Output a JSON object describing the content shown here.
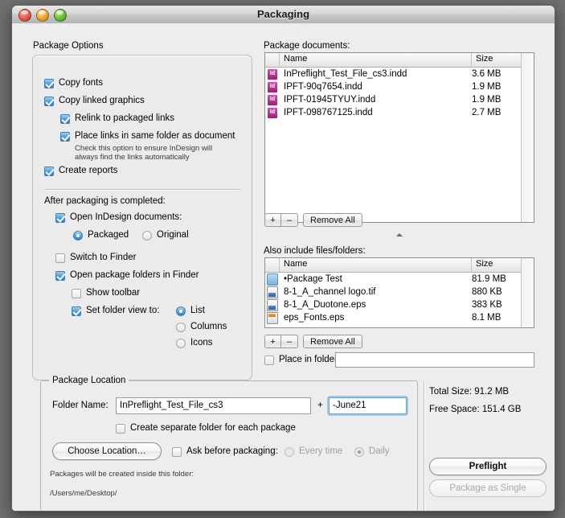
{
  "window": {
    "title": "Packaging"
  },
  "options_panel": {
    "title": "Package Options",
    "copy_fonts": "Copy fonts",
    "copy_linked_graphics": "Copy linked graphics",
    "relink": "Relink to packaged links",
    "place_links": "Place links in same folder as document",
    "hint_line1": "Check this option to ensure InDesign will",
    "hint_line2": "always find the links automatically",
    "create_reports": "Create reports",
    "after_packaging": "After packaging is completed:",
    "open_indesign_docs": "Open InDesign documents:",
    "radio_packaged": "Packaged",
    "radio_original": "Original",
    "switch_to_finder": "Switch to Finder",
    "open_pkg_folders": "Open package folders in Finder",
    "show_toolbar": "Show toolbar",
    "set_folder_view": "Set folder view to:",
    "view_list": "List",
    "view_columns": "Columns",
    "view_icons": "Icons"
  },
  "documents": {
    "label": "Package documents:",
    "columns": [
      "Name",
      "Size"
    ],
    "rows": [
      {
        "icon": "indesign-document-icon",
        "name": "InPreflight_Test_File_cs3.indd",
        "size": "3.6 MB"
      },
      {
        "icon": "indesign-document-icon",
        "name": "IPFT-90q7654.indd",
        "size": "1.9 MB"
      },
      {
        "icon": "indesign-document-icon",
        "name": "IPFT-01945TYUY.indd",
        "size": "1.9 MB"
      },
      {
        "icon": "indesign-document-icon",
        "name": "IPFT-098767125.indd",
        "size": "2.7 MB"
      }
    ],
    "add_label": "+",
    "remove_label": "–",
    "remove_all_label": "Remove All"
  },
  "also_include": {
    "label": "Also include files/folders:",
    "columns": [
      "Name",
      "Size"
    ],
    "rows": [
      {
        "icon": "folder-icon",
        "name": "•Package Test",
        "size": "81.9 MB"
      },
      {
        "icon": "tif-image-icon",
        "name": "8-1_A_channel logo.tif",
        "size": "880 KB"
      },
      {
        "icon": "tif-image-icon",
        "name": "8-1_A_Duotone.eps",
        "size": "383 KB"
      },
      {
        "icon": "eps-file-icon",
        "name": "eps_Fonts.eps",
        "size": "8.1 MB"
      }
    ],
    "add_label": "+",
    "remove_label": "–",
    "remove_all_label": "Remove All",
    "place_in_folder": "Place in folder:",
    "place_in_folder_value": ""
  },
  "package_location": {
    "title": "Package Location",
    "folder_name_label": "Folder Name:",
    "folder_name_value": "InPreflight_Test_File_cs3",
    "plus": "+",
    "suffix_value": "-June21",
    "create_separate": "Create separate folder for each package",
    "choose_location": "Choose Location…",
    "ask_before": "Ask before packaging:",
    "every_time": "Every time",
    "daily": "Daily",
    "note": "Packages will be created inside this folder:",
    "path": "/Users/me/Desktop/"
  },
  "summary": {
    "total_size": "Total Size:  91.2 MB",
    "free_space": "Free Space:  151.4 GB",
    "preflight": "Preflight",
    "package_as_single": "Package as Single"
  }
}
